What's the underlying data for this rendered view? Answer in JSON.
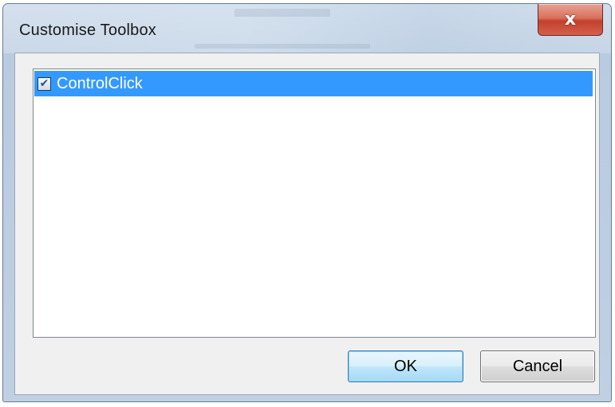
{
  "window": {
    "title": "Customise Toolbox",
    "close_glyph": "x"
  },
  "list": {
    "items": [
      {
        "label": "ControlClick",
        "checked": true,
        "selected": true,
        "check_glyph": "✔"
      }
    ]
  },
  "buttons": {
    "ok_label": "OK",
    "cancel_label": "Cancel"
  },
  "colors": {
    "selection": "#3399ff",
    "close_button": "#c2412d",
    "frame": "#bfd0e3"
  }
}
